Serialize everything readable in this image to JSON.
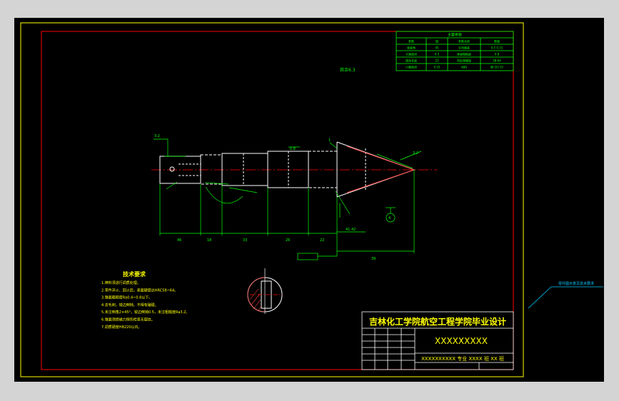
{
  "colors": {
    "background": "#000000",
    "frame_outer": "#ffff00",
    "frame_inner": "#ff0000",
    "geometry": "#ffffff",
    "dimension": "#00ff00",
    "centerline": "#ff0000",
    "callout": "#00c8ff",
    "title_text": "#ffff00",
    "table_text": "#00ff00"
  },
  "title_block": {
    "school": "吉林化工学院航空工程学院毕业设计",
    "drawing_name": "XXXXXXXXX",
    "class_line": "XXXXXXXXXX 专业 XXXX 班 XX 班"
  },
  "technical_requirements": {
    "heading": "技术要求",
    "items": [
      "1.棒料须进行调质处理。",
      "2.零件淬火、回火后，表面硬度达HRC58~64。",
      "3.锥面粗糙度Ra0.4~0.8以下。",
      "4.去毛刺，锐边倒钝，不得有磕碰。",
      "5.未注倒角2×45°，锐边倒钝0.5，未注粗糙度Ra3.2。",
      "6.锥面须经磁力探伤检查无裂纹。",
      "7.调质硬度HB220以内。"
    ]
  },
  "annotations": {
    "roughness_top": "其余6.3",
    "other_roughness": "3.2"
  },
  "param_table": {
    "title": "主要参数",
    "rows": [
      [
        "参数",
        "值",
        "参数名称",
        "数值"
      ],
      [
        "锥度角",
        "45",
        "许用偏差",
        "0.5 0.15"
      ],
      [
        "大端直径",
        "4.5",
        "表面粗糙度",
        "0.8"
      ],
      [
        "锥体长度",
        "23",
        "热处理硬度",
        "58-64"
      ],
      [
        "小端直径",
        "0.25",
        "材料",
        "钢 GCr15"
      ]
    ]
  },
  "callout_note": "零件图示意见技术要求"
}
